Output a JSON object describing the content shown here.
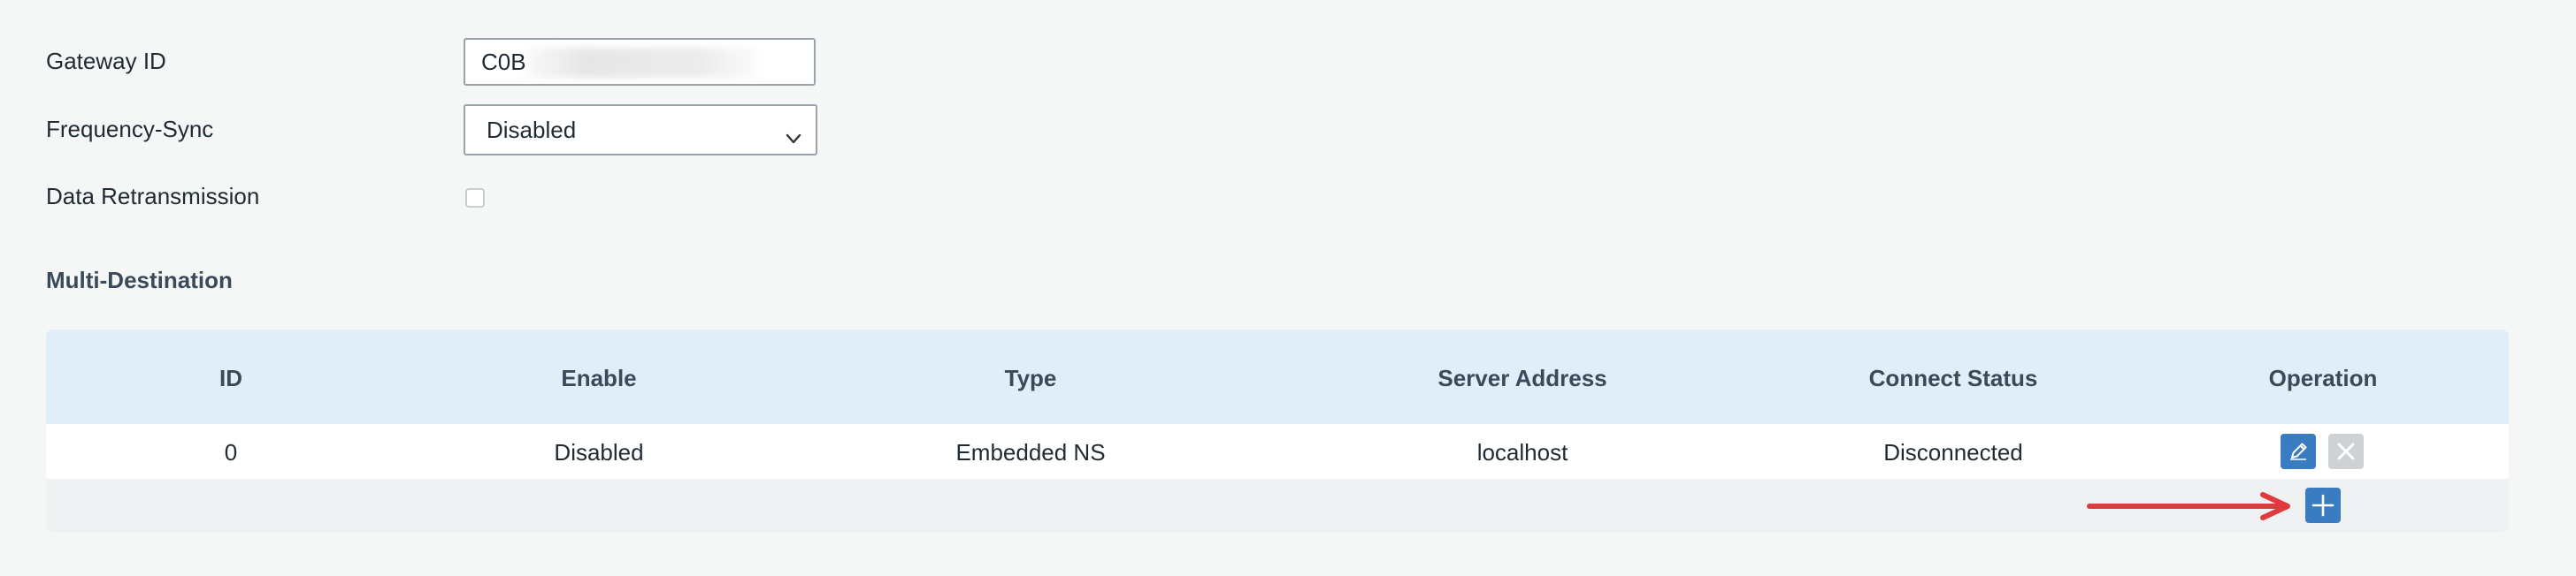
{
  "form": {
    "gateway_id": {
      "label": "Gateway ID",
      "value": "C0B"
    },
    "frequency_sync": {
      "label": "Frequency-Sync",
      "selected": "Disabled"
    },
    "data_retransmission": {
      "label": "Data Retransmission",
      "checked": false
    }
  },
  "multi_destination": {
    "title": "Multi-Destination",
    "columns": [
      "ID",
      "Enable",
      "Type",
      "Server Address",
      "Connect Status",
      "Operation"
    ],
    "rows": [
      {
        "id": "0",
        "enable": "Disabled",
        "type": "Embedded NS",
        "server_address": "localhost",
        "connect_status": "Disconnected"
      }
    ]
  },
  "icons": {
    "edit": "pencil-icon",
    "delete": "close-icon",
    "add": "plus-icon",
    "dropdown": "chevron-down-icon",
    "annotation": "red-arrow"
  },
  "colors": {
    "primary_button": "#3a7cc1",
    "disabled_button": "#cfd2d4",
    "header_background": "#e2eef7",
    "annotation_arrow": "#e03a3e"
  }
}
